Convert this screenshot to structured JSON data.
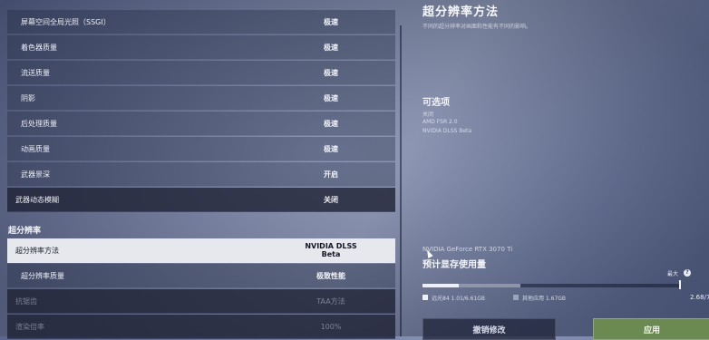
{
  "settings_rows": [
    {
      "label": "屏幕空间全局光照（SSGI）",
      "value": "极速"
    },
    {
      "label": "着色器质量",
      "value": "极速"
    },
    {
      "label": "流送质量",
      "value": "极速"
    },
    {
      "label": "阴影",
      "value": "极速"
    },
    {
      "label": "后处理质量",
      "value": "极速"
    },
    {
      "label": "动画质量",
      "value": "极速"
    },
    {
      "label": "武器景深",
      "value": "开启"
    },
    {
      "label": "武器动态模糊",
      "value": "关闭"
    }
  ],
  "upscale_section": {
    "title": "超分辨率",
    "rows": [
      {
        "label": "超分辨率方法",
        "value": "NVIDIA DLSS Beta"
      },
      {
        "label": "超分辨率质量",
        "value": "极致性能"
      },
      {
        "label": "抗锯齿",
        "value": "TAA方法"
      },
      {
        "label": "渲染倍率",
        "value": "100%"
      }
    ]
  },
  "info_panel": {
    "title": "超分辨率方法",
    "description": "不同的超分辨率对画面和性能有不同的影响。",
    "options_title": "可选项",
    "options": [
      "关闭",
      "AMD FSR 2.0",
      "NVIDIA DLSS Beta"
    ],
    "gpu_name": "NVIDIA GeForce RTX 3070 Ti",
    "vram_title": "预计显存使用量",
    "max_label": "最大",
    "vram_game_label": "远光84 1.01/6.61GB",
    "vram_other_label": "其他应用 1.67GB",
    "vram_total": "2.68/7",
    "vram_game_fraction": 0.14,
    "vram_other_fraction": 0.24,
    "colors": {
      "game": "#eef0f6",
      "other": "#bec4d6",
      "apply": "#6a8a52"
    }
  },
  "buttons": {
    "cancel": "撤销修改",
    "apply": "应用"
  }
}
